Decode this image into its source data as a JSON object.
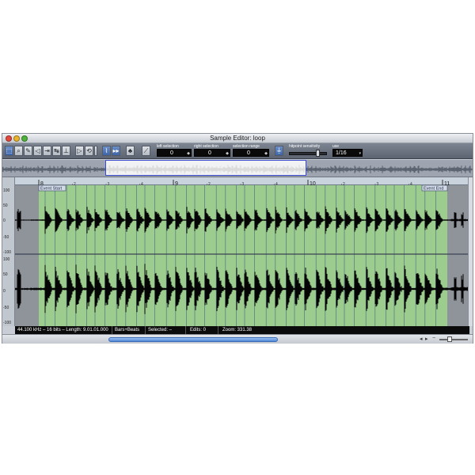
{
  "window": {
    "title": "Sample Editor: loop"
  },
  "toolbar": {
    "tools": [
      {
        "icon": "range-selection-icon",
        "glyph": "⬚"
      },
      {
        "icon": "zoom-icon",
        "glyph": "🔍"
      },
      {
        "icon": "pencil-icon",
        "glyph": "✎"
      },
      {
        "icon": "speaker-icon",
        "glyph": "◁"
      },
      {
        "icon": "scrub-icon",
        "glyph": "⇥"
      },
      {
        "icon": "time-warp-icon",
        "glyph": "↹"
      },
      {
        "icon": "hitpoint-icon",
        "glyph": "⊥"
      }
    ],
    "play_icon": "play-icon",
    "loop_icon": "loop-icon",
    "fields": {
      "left_selection": {
        "label": "left selection",
        "value": "0"
      },
      "right_selection": {
        "label": "right selection",
        "value": "0"
      },
      "selection_range": {
        "label": "selection range",
        "value": "0"
      },
      "hitpoint_sensitivity": {
        "label": "hitpoint sensitivity",
        "level": 0.72
      },
      "use": {
        "label": "use",
        "value": "1/16"
      }
    }
  },
  "ruler": {
    "bars": [
      "8",
      "9",
      "10",
      "11"
    ],
    "beats": [
      "2",
      "3",
      "4",
      "2",
      "3",
      "4",
      "2",
      "3",
      "4",
      "2"
    ]
  },
  "markers": {
    "event_start": "Event Start",
    "event_end": "Event End"
  },
  "scale": {
    "labels": [
      "100",
      "50",
      "0",
      "-50",
      "-100",
      "100",
      "50",
      "0",
      "-50",
      "-100"
    ]
  },
  "status": {
    "format": "44.100 kHz – 16 bits – Length: 9.01.01.000",
    "ruler_mode": "Bars+Beats",
    "selected": "Selected: –",
    "edits": "Edits: 0",
    "zoom": "Zoom: 331.38"
  },
  "colors": {
    "slice_green": "#9ccd8e",
    "waveform": "#050505",
    "outside_region": "#8f949b",
    "overview_border": "#3a4ccc"
  }
}
